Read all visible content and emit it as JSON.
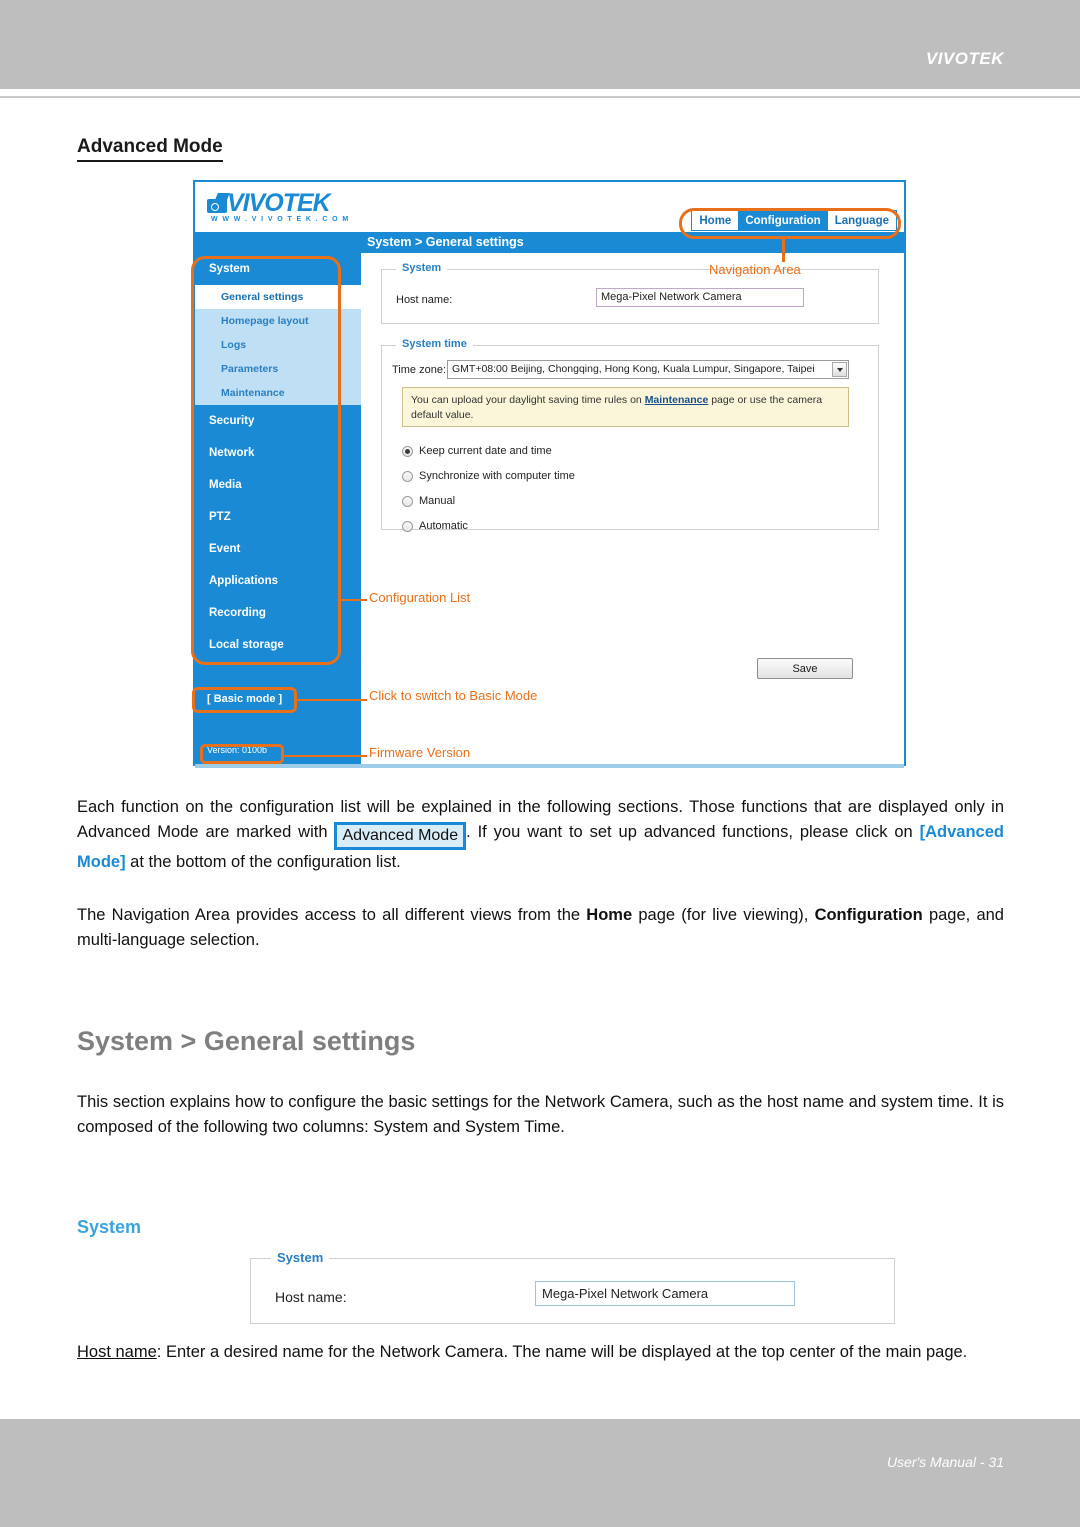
{
  "header": {
    "brand": "VIVOTEK"
  },
  "heading_advanced_mode": "Advanced Mode",
  "figure": {
    "logo": {
      "word": "VIVOTEK",
      "url": "W W W . V I V O T E K . C O M"
    },
    "nav": {
      "home": "Home",
      "configuration": "Configuration",
      "language": "Language"
    },
    "titlebar": {
      "breadcrumb": "System  > General settings"
    },
    "sidebar": {
      "system": "System",
      "subitems": [
        {
          "label": "General settings",
          "selected": true
        },
        {
          "label": "Homepage layout",
          "selected": false
        },
        {
          "label": "Logs",
          "selected": false
        },
        {
          "label": "Parameters",
          "selected": false
        },
        {
          "label": "Maintenance",
          "selected": false
        }
      ],
      "groups": [
        "Security",
        "Network",
        "Media",
        "PTZ",
        "Event",
        "Applications",
        "Recording",
        "Local storage"
      ],
      "basic_mode": "[ Basic mode ]",
      "version": "Version: 0100b"
    },
    "annotations": {
      "navigation_area": "Navigation Area",
      "configuration_list": "Configuration List",
      "basic_mode_hint": "Click to switch to Basic Mode",
      "firmware_version": "Firmware Version",
      "color": "#e8701a"
    },
    "system_fieldset": {
      "legend": "System",
      "host_name_label": "Host name:",
      "host_name_value": "Mega-Pixel Network Camera"
    },
    "system_time_fieldset": {
      "legend": "System time",
      "time_zone_label": "Time zone:",
      "time_zone_value": "GMT+08:00 Beijing, Chongqing, Hong Kong, Kuala Lumpur, Singapore, Taipei",
      "note_before": "You can upload your daylight saving time rules on ",
      "note_link": "Maintenance",
      "note_after": " page or use the camera default value.",
      "options": [
        {
          "label": "Keep current date and time",
          "checked": true
        },
        {
          "label": "Synchronize with computer time",
          "checked": false
        },
        {
          "label": "Manual",
          "checked": false
        },
        {
          "label": "Automatic",
          "checked": false
        }
      ]
    },
    "save_button": "Save"
  },
  "body": {
    "p1_a": "Each function on the configuration list will be explained in the following sections. Those functions that are displayed only in Advanced Mode are marked with ",
    "p1_badge": "Advanced Mode",
    "p1_b": ". If you want to set up advanced functions, please click on ",
    "p1_link": "[Advanced Mode]",
    "p1_c": " at the bottom of the configuration list.",
    "p2_a": "The Navigation Area provides access to all different views from the ",
    "p2_b1": "Home",
    "p2_b": " page (for live viewing), ",
    "p2_b2": "Configuration",
    "p2_c": " page, and multi-language selection.",
    "section_heading": "System > General settings",
    "p3": "This section explains how to configure the basic settings for the Network Camera, such as the host name and system time. It is composed of the following two columns: System and System Time.",
    "sub_heading": "System",
    "figure2": {
      "legend": "System",
      "host_name_label": "Host name:",
      "host_name_value": "Mega-Pixel Network Camera"
    },
    "p4_label": "Host name",
    "p4_text": ": Enter a desired name for the Network Camera. The name will be displayed at the top center of the main page."
  },
  "footer": {
    "note": "User's Manual - 31"
  }
}
